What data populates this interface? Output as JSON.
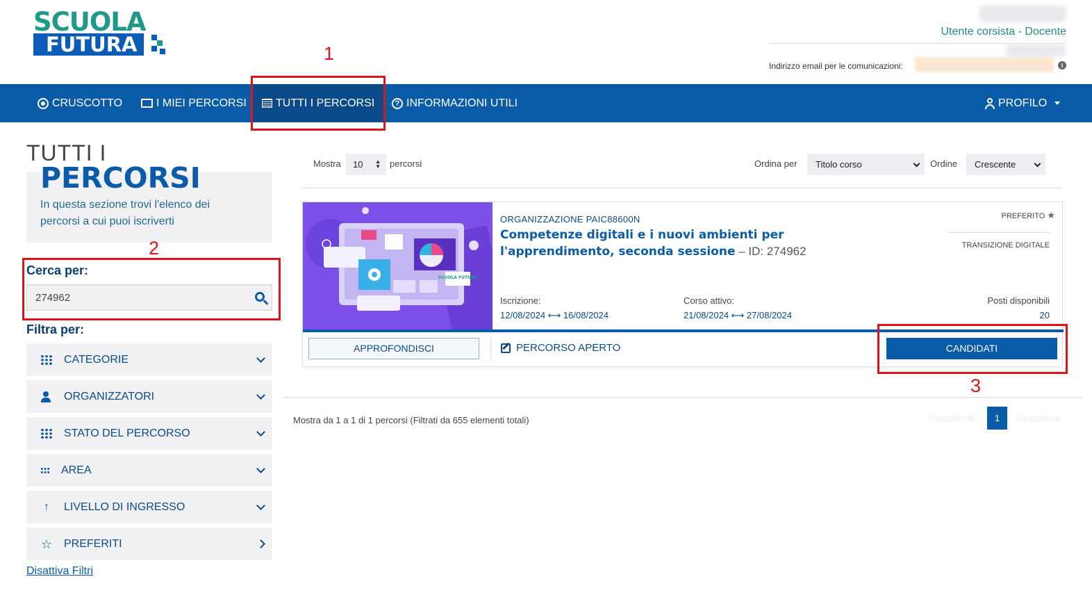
{
  "brand": {
    "line1": "SCUOLA",
    "line2": "FUTURA"
  },
  "user": {
    "role": "Utente corsista - Docente",
    "email_label": "Indirizzo email per le comunicazioni:",
    "info_icon": "i"
  },
  "nav": {
    "items": [
      {
        "label": "CRUSCOTTO",
        "icon": "target-icon"
      },
      {
        "label": "I MIEI PERCORSI",
        "icon": "monitor-icon"
      },
      {
        "label": "TUTTI I PERCORSI",
        "icon": "list-icon"
      },
      {
        "label": "INFORMAZIONI UTILI",
        "icon": "question-icon"
      }
    ],
    "profile_label": "PROFILO"
  },
  "annotations": [
    "1",
    "2",
    "3"
  ],
  "sidebar": {
    "title_line1": "TUTTI I",
    "title_line2": "PERCORSI",
    "description": "In questa sezione trovi l'elenco dei percorsi a cui puoi iscriverti",
    "search_label": "Cerca per:",
    "search_value": "274962",
    "filter_label": "Filtra per:",
    "filters": [
      {
        "label": "CATEGORIE",
        "icon": "grid-icon"
      },
      {
        "label": "ORGANIZZATORI",
        "icon": "person-icon"
      },
      {
        "label": "STATO DEL PERCORSO",
        "icon": "grid-icon"
      },
      {
        "label": "AREA",
        "icon": "dots-grid-icon"
      },
      {
        "label": "LIVELLO DI INGRESSO",
        "icon": "arrow-up-icon"
      },
      {
        "label": "PREFERITI",
        "icon": "star-icon"
      }
    ],
    "disable_filters": "Disattiva Filtri"
  },
  "toolbar": {
    "show_label": "Mostra",
    "show_value": "10",
    "show_suffix": "percorsi",
    "sort_label": "Ordina per",
    "sort_value": "Titolo corso",
    "order_label": "Ordine",
    "order_value": "Crescente"
  },
  "course": {
    "organization": "ORGANIZZAZIONE PAIC88600N",
    "title": "Competenze digitali e i nuovi ambienti per l'apprendimento, seconda sessione",
    "id_text": " – ID: 274962",
    "favorite_label": "PREFERITO",
    "category": "TRANSIZIONE DIGITALE",
    "enroll_label": "Iscrizione:",
    "enroll_dates": "12/08/2024 ⟷ 16/08/2024",
    "active_label": "Corso attivo:",
    "active_dates": "21/08/2024 ⟷ 27/08/2024",
    "seats_label": "Posti disponibili",
    "seats_value": "20",
    "details_button": "APPROFONDISCI",
    "status_link": "PERCORSO APERTO",
    "apply_button": "CANDIDATI",
    "image_badge": "SCUOLA FUTURA"
  },
  "pagination": {
    "info": "Mostra da 1 a 1 di 1 percorsi (Filtrati da 655 elementi totali)",
    "prev": "Precedente",
    "current": "1",
    "next": "Successivo"
  },
  "colors": {
    "primary": "#0a5ca8",
    "teal": "#1f9a8a",
    "annotation": "#e0121a"
  }
}
